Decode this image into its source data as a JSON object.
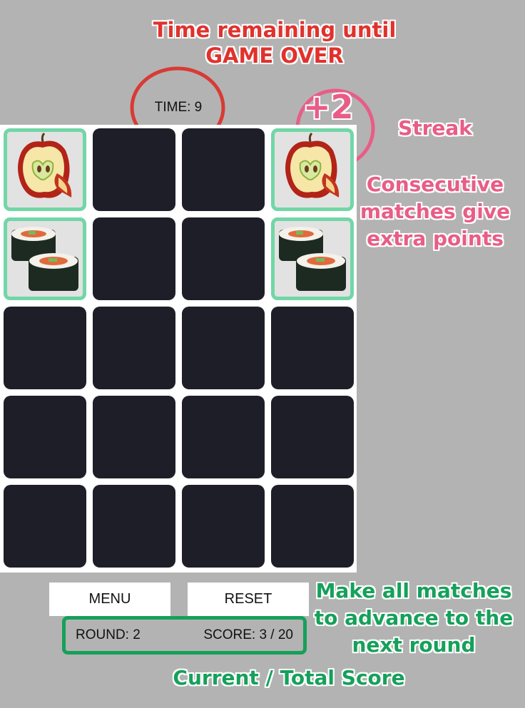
{
  "annotations": {
    "time_title_line1": "Time remaining until",
    "time_title_line2": "GAME OVER",
    "streak_value": "+2",
    "streak_label": "Streak",
    "streak_desc_line1": "Consecutive",
    "streak_desc_line2": "matches give",
    "streak_desc_line3": "extra points",
    "advance_line1": "Make all matches",
    "advance_line2": "to advance to the",
    "advance_line3": "next round",
    "score_caption": "Current / Total Score"
  },
  "hud": {
    "time": "TIME: 9",
    "round": "ROUND: 2",
    "score": "SCORE: 3 / 20"
  },
  "buttons": {
    "menu": "MENU",
    "reset": "RESET"
  },
  "board": {
    "rows": 5,
    "cols": 4,
    "cards": [
      [
        "apple",
        "hidden",
        "hidden",
        "apple"
      ],
      [
        "sushi",
        "hidden",
        "hidden",
        "sushi"
      ],
      [
        "hidden",
        "hidden",
        "hidden",
        "hidden"
      ],
      [
        "hidden",
        "hidden",
        "hidden",
        "hidden"
      ],
      [
        "hidden",
        "hidden",
        "hidden",
        "hidden"
      ]
    ]
  },
  "colors": {
    "time_annotation": "#e0322d",
    "streak_annotation": "#e85d86",
    "score_annotation": "#16a05a",
    "card_back": "#1e1e28",
    "matched_border": "#72d6a7"
  }
}
